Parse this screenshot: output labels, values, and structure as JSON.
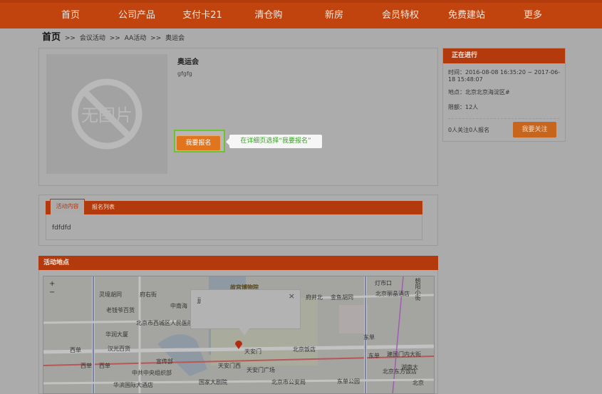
{
  "nav": {
    "items": [
      "首页",
      "公司产品",
      "支付卡21",
      "清仓购",
      "新房",
      "会员特权",
      "免费建站",
      "更多"
    ]
  },
  "breadcrumb": {
    "home": "首页",
    "sep": ">>",
    "items": [
      "会议活动",
      "AA活动",
      "奥运会"
    ]
  },
  "event": {
    "title": "奥运会",
    "description": "gfgfg",
    "signup_label": "我要报名",
    "tip": "在详细页选择“我要报名”",
    "noimage_text": "无图片"
  },
  "side": {
    "header": "正在进行",
    "time": "时间：2016-08-08 16:35:20 ~ 2017-06-18 15:48:07",
    "place": "地点：北京北京海淀区#",
    "quota": "限额：12人",
    "stats": "0人关注0人报名",
    "follow_label": "我要关注"
  },
  "tabs": {
    "items": [
      "活动内容",
      "报名列表"
    ],
    "content": "fdfdfd"
  },
  "location": {
    "header": "活动地点",
    "popup_text": "jj",
    "popup_close": "×",
    "map_labels": [
      "灵境胡同",
      "府右街",
      "老钱爷百货",
      "中南海",
      "北京市西城区人民医院",
      "华润大厦",
      "西单",
      "汉光百货",
      "西单",
      "西单",
      "宣传部",
      "中共中央组织部",
      "华滨国际大酒店",
      "故宫博物院",
      "天安门",
      "天安门西",
      "天安门广场",
      "国家大剧院",
      "府井北",
      "金鱼胡同",
      "灯市口",
      "北京丽晶酒店",
      "北京饭店",
      "东单",
      "东单",
      "建国门内大街",
      "湖南大",
      "北京东方饭店",
      "东单公园",
      "北京市公安局",
      "朝阳小街",
      "北京"
    ]
  }
}
